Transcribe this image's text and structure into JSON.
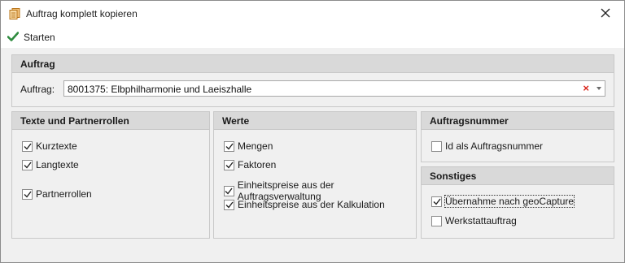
{
  "window": {
    "title": "Auftrag komplett kopieren",
    "accent_color": "#2e8b3e"
  },
  "toolbar": {
    "start_label": "Starten",
    "start_icon": "checkmark-icon"
  },
  "auftrag": {
    "header": "Auftrag",
    "field_label": "Auftrag:",
    "value": "8001375: Elbphilharmonie und Laeiszhalle",
    "clear_glyph": "×"
  },
  "texte": {
    "header": "Texte und Partnerrollen",
    "items": [
      {
        "label": "Kurztexte",
        "checked": true
      },
      {
        "label": "Langtexte",
        "checked": true
      },
      {
        "label": "Partnerrollen",
        "checked": true
      }
    ]
  },
  "werte": {
    "header": "Werte",
    "items": [
      {
        "label": "Mengen",
        "checked": true
      },
      {
        "label": "Faktoren",
        "checked": true
      },
      {
        "label": "Einheitspreise aus der Auftragsverwaltung",
        "checked": true
      },
      {
        "label": "Einheitspreise aus der Kalkulation",
        "checked": true
      }
    ]
  },
  "auftragsnummer": {
    "header": "Auftragsnummer",
    "items": [
      {
        "label": "Id als Auftragsnummer",
        "checked": false
      }
    ]
  },
  "sonstiges": {
    "header": "Sonstiges",
    "items": [
      {
        "label": "Übernahme nach geoCapture",
        "checked": true
      },
      {
        "label": "Werkstattauftrag",
        "checked": false
      }
    ]
  }
}
